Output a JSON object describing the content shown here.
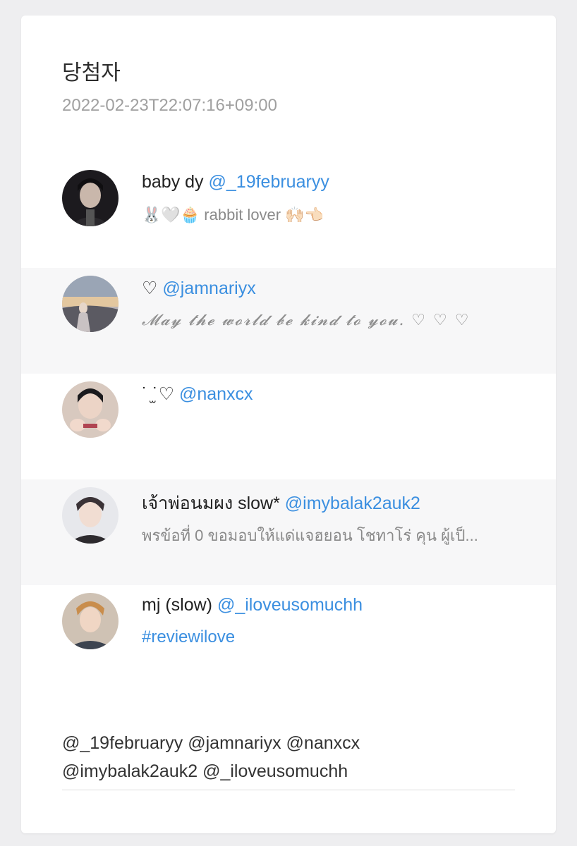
{
  "header": {
    "title": "당첨자",
    "timestamp": "2022-02-23T22:07:16+09:00"
  },
  "winners": [
    {
      "display_name": "baby dy",
      "handle": "@_19februaryy",
      "bio": "🐰🤍🧁 rabbit lover 🙌🏻👈🏻",
      "avatar_icon": "profile-photo"
    },
    {
      "display_name": "♡",
      "handle": "@jamnariyx",
      "bio": "𝓜𝓪𝔂 𝓽𝓱𝓮 𝔀𝓸𝓻𝓵𝓭 𝓫𝓮 𝓴𝓲𝓷𝓭 𝓽𝓸 𝔂𝓸𝓾. ♡ ♡ ♡",
      "avatar_icon": "profile-photo"
    },
    {
      "display_name": "˙ ̫˙♡",
      "handle": "@nanxcx",
      "bio": "",
      "avatar_icon": "profile-photo"
    },
    {
      "display_name": "เจ้าพ่อนมผง slow*",
      "handle": "@imybalak2auk2",
      "bio": "พรข้อที่ 0 ขอมอบให้แด่แจฮยอน โชทาโร่ คุน ผู้เป็...",
      "avatar_icon": "profile-photo"
    },
    {
      "display_name": "mj (slow)",
      "handle": "@_iloveusomuchh",
      "bio": "#reviewilove",
      "avatar_icon": "profile-photo"
    }
  ],
  "footer": {
    "mentions_line1": "@_19februaryy @jamnariyx @nanxcx",
    "mentions_line2": "@imybalak2auk2 @_iloveusomuchh"
  },
  "colors": {
    "link": "#3b8fe0",
    "muted": "#a0a0a0",
    "alt_row": "#f7f7f8"
  }
}
